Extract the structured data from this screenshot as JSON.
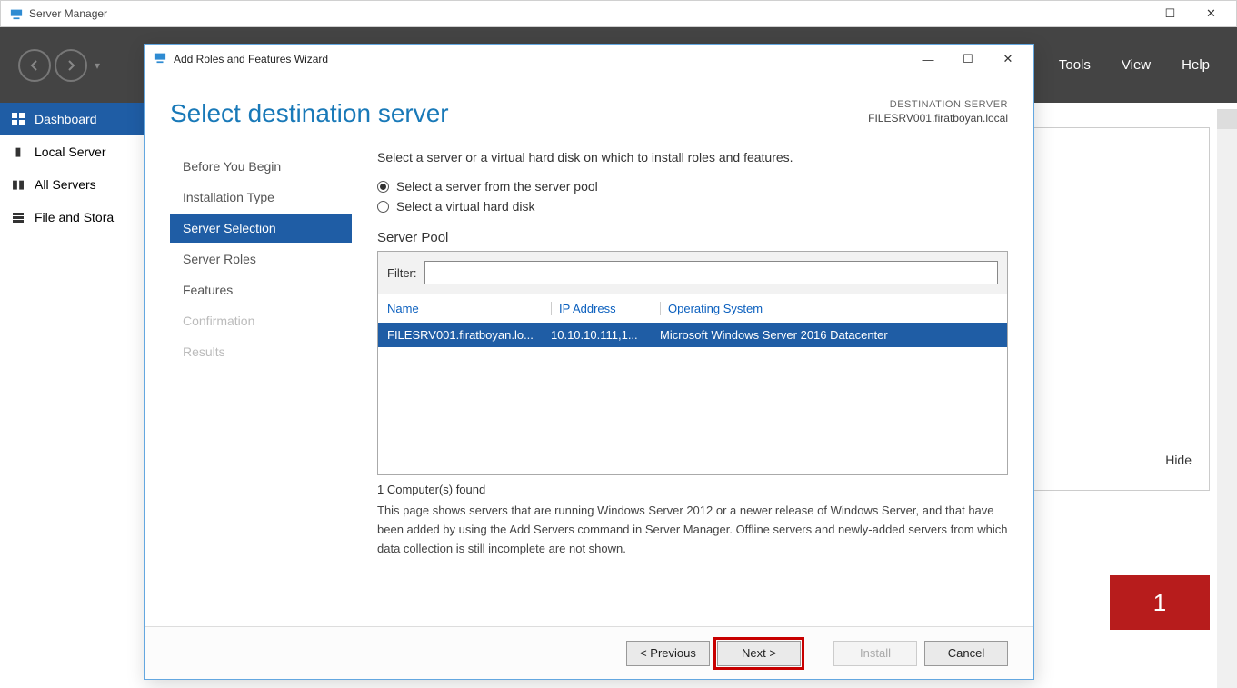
{
  "outer": {
    "title": "Server Manager",
    "controls": {
      "min": "—",
      "max": "☐",
      "close": "✕"
    }
  },
  "darkbar": {
    "tools": "Tools",
    "view": "View",
    "help": "Help"
  },
  "leftnav": {
    "items": [
      {
        "label": "Dashboard",
        "selected": true,
        "icon": "dashboard"
      },
      {
        "label": "Local Server",
        "selected": false,
        "icon": "server"
      },
      {
        "label": "All Servers",
        "selected": false,
        "icon": "servers"
      },
      {
        "label": "File and Stora",
        "selected": false,
        "icon": "file"
      }
    ]
  },
  "backpanel": {
    "hide": "Hide",
    "count": "1"
  },
  "wizard": {
    "title": "Add Roles and Features Wizard",
    "controls": {
      "min": "—",
      "max": "☐",
      "close": "✕"
    },
    "heading": "Select destination server",
    "destLabel": "DESTINATION SERVER",
    "destServer": "FILESRV001.firatboyan.local",
    "steps": [
      {
        "label": "Before You Begin",
        "state": "normal"
      },
      {
        "label": "Installation Type",
        "state": "normal"
      },
      {
        "label": "Server Selection",
        "state": "active"
      },
      {
        "label": "Server Roles",
        "state": "normal"
      },
      {
        "label": "Features",
        "state": "normal"
      },
      {
        "label": "Confirmation",
        "state": "disabled"
      },
      {
        "label": "Results",
        "state": "disabled"
      }
    ],
    "instruction": "Select a server or a virtual hard disk on which to install roles and features.",
    "radio1": "Select a server from the server pool",
    "radio2": "Select a virtual hard disk",
    "poolLabel": "Server Pool",
    "filterLabel": "Filter:",
    "filterValue": "",
    "columns": {
      "name": "Name",
      "ip": "IP Address",
      "os": "Operating System"
    },
    "rows": [
      {
        "name": "FILESRV001.firatboyan.lo...",
        "ip": "10.10.10.111,1...",
        "os": "Microsoft Windows Server 2016 Datacenter"
      }
    ],
    "foundText": "1 Computer(s) found",
    "description": "This page shows servers that are running Windows Server 2012 or a newer release of Windows Server, and that have been added by using the Add Servers command in Server Manager. Offline servers and newly-added servers from which data collection is still incomplete are not shown.",
    "buttons": {
      "prev": "< Previous",
      "next": "Next >",
      "install": "Install",
      "cancel": "Cancel"
    }
  }
}
